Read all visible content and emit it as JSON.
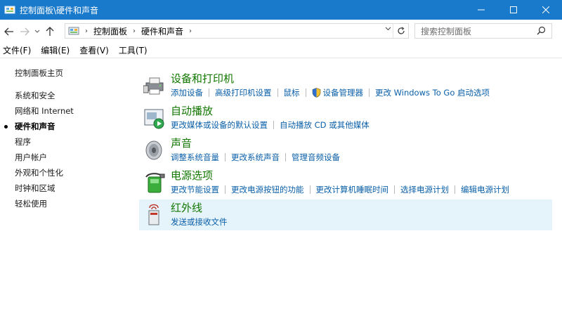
{
  "window": {
    "title": "控制面板\\硬件和声音",
    "minimize": "—",
    "maximize": "☐",
    "close": "✕"
  },
  "address": {
    "breadcrumb": [
      "控制面板",
      "硬件和声音"
    ],
    "search_placeholder": "搜索控制面板"
  },
  "menu": [
    "文件(F)",
    "编辑(E)",
    "查看(V)",
    "工具(T)"
  ],
  "sidebar": {
    "home": "控制面板主页",
    "items": [
      "系统和安全",
      "网络和 Internet",
      "硬件和声音",
      "程序",
      "用户帐户",
      "外观和个性化",
      "时钟和区域",
      "轻松使用"
    ],
    "current_index": 2
  },
  "categories": [
    {
      "title": "设备和打印机",
      "icon": "printer-icon",
      "links": [
        "添加设备",
        "高级打印机设置",
        "鼠标",
        "设备管理器",
        "更改 Windows To Go 启动选项"
      ]
    },
    {
      "title": "自动播放",
      "icon": "autoplay-icon",
      "links": [
        "更改媒体或设备的默认设置",
        "自动播放 CD 或其他媒体"
      ]
    },
    {
      "title": "声音",
      "icon": "speaker-icon",
      "links": [
        "调整系统音量",
        "更改系统声音",
        "管理音频设备"
      ]
    },
    {
      "title": "电源选项",
      "icon": "power-options-icon",
      "links": [
        "更改节能设置",
        "更改电源按钮的功能",
        "更改计算机睡眠时间",
        "选择电源计划",
        "编辑电源计划"
      ]
    },
    {
      "title": "红外线",
      "icon": "infrared-icon",
      "links": [
        "发送或接收文件"
      ],
      "selected": true
    }
  ],
  "colors": {
    "titlebar": "#1979ca",
    "heading": "#127700",
    "link": "#0a5fa8",
    "selected_bg": "#e5f3fb"
  }
}
